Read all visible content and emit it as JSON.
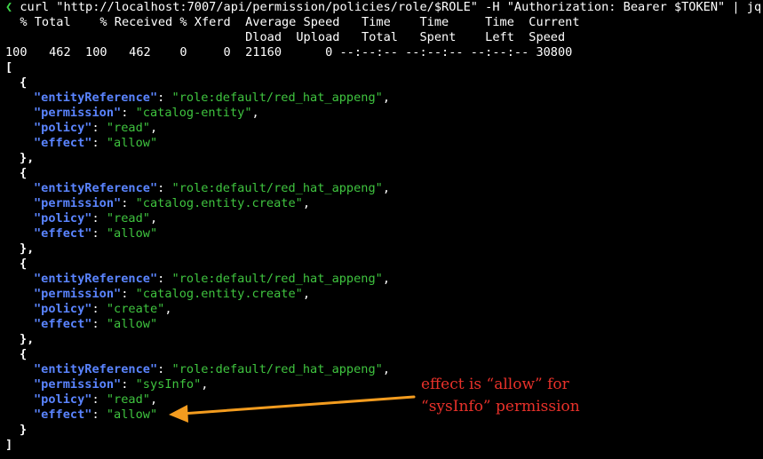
{
  "terminal": {
    "prompt_symbol": "❮",
    "command": " curl \"http://localhost:7007/api/permission/policies/role/$ROLE\" -H \"Authorization: Bearer $TOKEN\" | jq",
    "progress_header_1": "  % Total    % Received % Xferd  Average Speed   Time    Time     Time  Current",
    "progress_header_2": "                                 Dload  Upload   Total   Spent    Left  Speed",
    "progress_values": "100   462  100   462    0     0  21160      0 --:--:-- --:--:-- --:--:-- 30800",
    "array_open": "[",
    "array_close": "]",
    "object_open": "{",
    "object_close": "},",
    "object_close_last": "}",
    "keys": {
      "entity_reference": "\"entityReference\"",
      "permission": "\"permission\"",
      "policy": "\"policy\"",
      "effect": "\"effect\""
    },
    "separators": {
      "colon": ": ",
      "comma": ","
    },
    "policies": [
      {
        "entityReference": "\"role:default/red_hat_appeng\"",
        "permission": "\"catalog-entity\"",
        "policy": "\"read\"",
        "effect": "\"allow\""
      },
      {
        "entityReference": "\"role:default/red_hat_appeng\"",
        "permission": "\"catalog.entity.create\"",
        "policy": "\"read\"",
        "effect": "\"allow\""
      },
      {
        "entityReference": "\"role:default/red_hat_appeng\"",
        "permission": "\"catalog.entity.create\"",
        "policy": "\"create\"",
        "effect": "\"allow\""
      },
      {
        "entityReference": "\"role:default/red_hat_appeng\"",
        "permission": "\"sysInfo\"",
        "policy": "\"read\"",
        "effect": "\"allow\""
      }
    ]
  },
  "annotation": {
    "line1": "effect is “allow” for",
    "line2": "“sysInfo” permission"
  },
  "colors": {
    "background": "#000000",
    "key": "#5a84ff",
    "string": "#3fc43f",
    "prompt": "#3fd44a",
    "annotation_text": "#e8312a",
    "annotation_arrow": "#f39c1f"
  }
}
